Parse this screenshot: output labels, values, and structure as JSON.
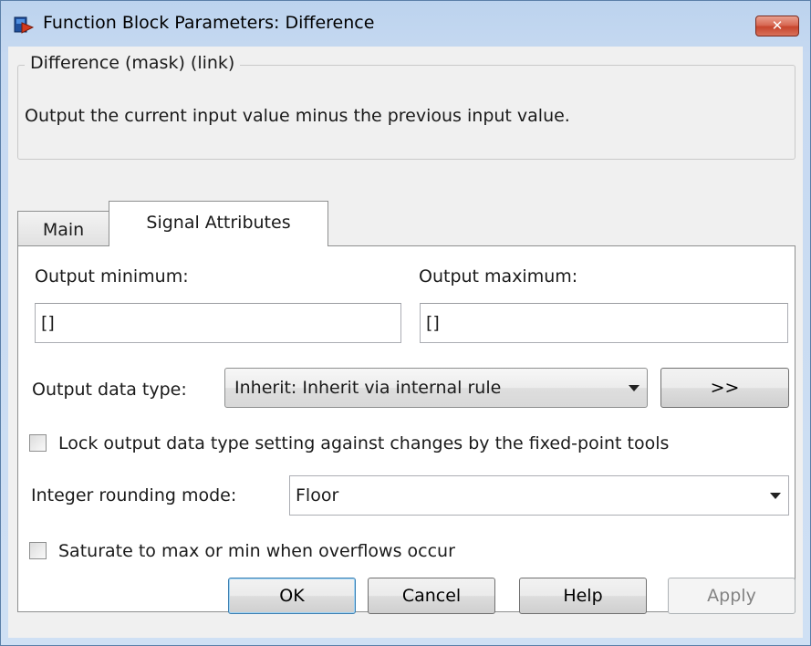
{
  "window": {
    "title": "Function Block Parameters: Difference",
    "close_glyph": "✕"
  },
  "header": {
    "group_title": "Difference (mask) (link)",
    "description": "Output the current input value minus the previous input value."
  },
  "tabs": [
    {
      "label": "Main",
      "active": false
    },
    {
      "label": "Signal Attributes",
      "active": true
    }
  ],
  "signal_attributes": {
    "output_min_label": "Output minimum:",
    "output_min_value": "[]",
    "output_max_label": "Output maximum:",
    "output_max_value": "[]",
    "data_type_label": "Output data type:",
    "data_type_value": "Inherit: Inherit via internal rule",
    "data_type_assistant_button": ">>",
    "lock_label": "Lock output data type setting against changes by the fixed-point tools",
    "lock_checked": false,
    "rounding_label": "Integer rounding mode:",
    "rounding_value": "Floor",
    "saturate_label": "Saturate to max or min when overflows occur",
    "saturate_checked": false
  },
  "buttons": {
    "ok": "OK",
    "cancel": "Cancel",
    "help": "Help",
    "apply": "Apply"
  },
  "icons": {
    "app": "simulink-block-icon",
    "close": "close-icon",
    "dropdown": "chevron-down-icon"
  },
  "colors": {
    "close_button": "#c7452d",
    "default_button_border": "#3c7fb1",
    "window_frame": "#c6d9f1"
  }
}
